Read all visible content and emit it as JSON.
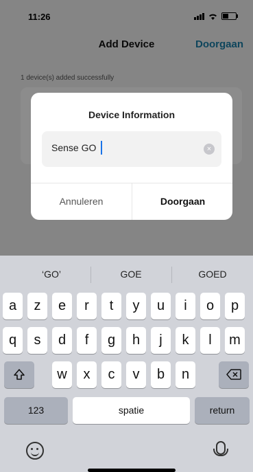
{
  "status_bar": {
    "time": "11:26",
    "battery_level": 0.45
  },
  "nav": {
    "title": "Add Device",
    "action": "Doorgaan"
  },
  "background": {
    "added_text": "1 device(s) added successfully"
  },
  "dialog": {
    "title": "Device Information",
    "input_value": "Sense GO",
    "cancel_label": "Annuleren",
    "confirm_label": "Doorgaan"
  },
  "keyboard": {
    "suggestions": [
      "‘GO’",
      "GOE",
      "GOED"
    ],
    "row1": [
      "a",
      "z",
      "e",
      "r",
      "t",
      "y",
      "u",
      "i",
      "o",
      "p"
    ],
    "row2": [
      "q",
      "s",
      "d",
      "f",
      "g",
      "h",
      "j",
      "k",
      "l",
      "m"
    ],
    "row3": [
      "w",
      "x",
      "c",
      "v",
      "b",
      "n"
    ],
    "shift_icon": "shift-arrow-icon",
    "delete_icon": "backspace-icon",
    "numbers_label": "123",
    "space_label": "spatie",
    "return_label": "return",
    "emoji_icon": "emoji-face-icon",
    "mic_icon": "microphone-icon"
  },
  "colors": {
    "accent": "#1a7ea8",
    "keyboard_bg": "#d1d3d9",
    "key_bg": "#ffffff",
    "special_key_bg": "#abb0bb"
  }
}
